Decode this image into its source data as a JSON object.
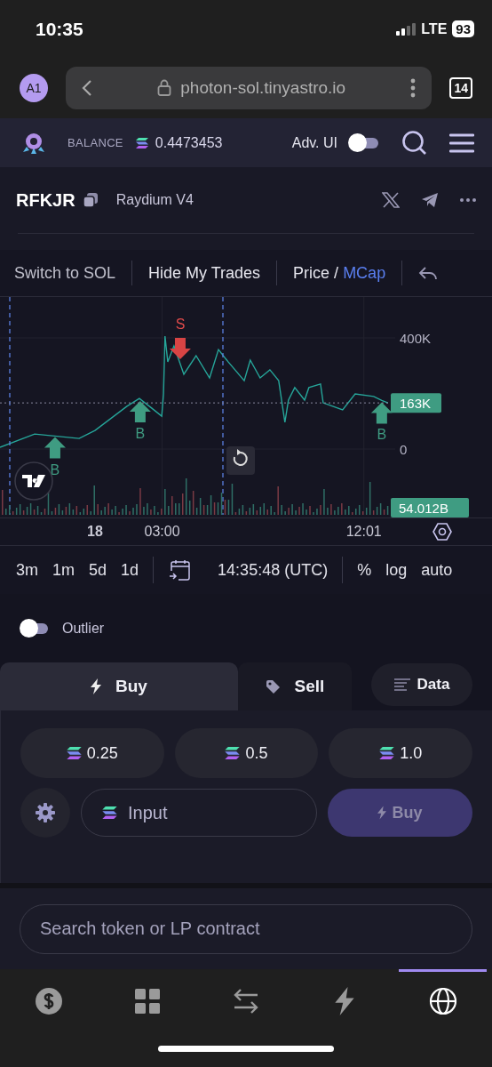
{
  "status_bar": {
    "time": "10:35",
    "network": "LTE",
    "battery": "93"
  },
  "browser": {
    "profile": "A1",
    "url": "photon-sol.tinyastro.io",
    "tab_count": "14"
  },
  "header": {
    "balance_label": "BALANCE",
    "balance": "0.4473453",
    "adv_ui_label": "Adv. UI",
    "adv_ui_on": false
  },
  "token": {
    "symbol": "RFKJR",
    "dex": "Raydium V4"
  },
  "chart_toolbar": {
    "switch_label": "Switch to SOL",
    "hide_trades_label": "Hide My Trades",
    "separator": "/",
    "modes": [
      {
        "label": "Price",
        "selected": false
      },
      {
        "label": "MCap",
        "selected": true
      }
    ]
  },
  "chart": {
    "price_label": "163K",
    "volume_label": "54.012B",
    "chart_data": {
      "type": "line",
      "x": [
        -4.25,
        -2.7,
        -0.71,
        0,
        1.43,
        1.98,
        2.54,
        2.98,
        3.06,
        3.13,
        3.25,
        3.53,
        3.97,
        4.52,
        5.12,
        5.52,
        5.95,
        6.67,
        6.94,
        7.38,
        7.82,
        8.21,
        8.49,
        8.65,
        8.93,
        9.37,
        9.56,
        10.08,
        10.2,
        11.07,
        11.63,
        12.46,
        12.82,
        13.1
      ],
      "series": [
        {
          "color": "#26a69a",
          "values": [
            6000,
            54000,
            38000,
            67000,
            154000,
            182000,
            147000,
            118000,
            198000,
            406000,
            314000,
            371000,
            269000,
            336000,
            256000,
            358000,
            314000,
            246000,
            320000,
            256000,
            285000,
            246000,
            96000,
            176000,
            221000,
            176000,
            221000,
            234000,
            166000,
            141000,
            198000,
            189000,
            175000,
            166000
          ]
        }
      ],
      "xlim": [
        -4.25,
        17.75
      ],
      "ylim": [
        -246400,
        547200
      ],
      "grid": true,
      "yticks": [
        {
          "value": 400000,
          "label": "400K"
        },
        {
          "value": 0,
          "label": "0"
        }
      ],
      "xticks": [
        {
          "value": 3,
          "label": "03:00"
        },
        {
          "value": 12.02,
          "label": "12:01"
        }
      ],
      "annotations": [
        {
          "text": "B",
          "x": -1.79,
          "y": 40000
        },
        {
          "text": "B",
          "x": 2.02,
          "y": 170000
        },
        {
          "text": "S",
          "x": 3.81,
          "y": 330000
        },
        {
          "text": "B",
          "x": 12.82,
          "y": 165000
        }
      ]
    },
    "day_label": "18"
  },
  "intervals": [
    {
      "label": "3m"
    },
    {
      "label": "1m"
    },
    {
      "label": "5d"
    },
    {
      "label": "1d"
    }
  ],
  "clock": "14:35:48 (UTC)",
  "scale_options": [
    {
      "label": "%"
    },
    {
      "label": "log"
    },
    {
      "label": "auto"
    }
  ],
  "outlier": {
    "label": "Outlier",
    "on": false
  },
  "trade_tabs": [
    {
      "kind": "buy",
      "label": "Buy",
      "selected": true
    },
    {
      "kind": "sell",
      "label": "Sell",
      "selected": false
    }
  ],
  "data_button": "Data",
  "quick_amounts": [
    "0.25",
    "0.5",
    "1.0"
  ],
  "amount_input": {
    "placeholder": "Input"
  },
  "buy_button": {
    "label": "Buy",
    "disabled": true
  },
  "search": {
    "placeholder": "Search token or LP contract"
  },
  "bottom_nav": [
    {
      "kind": "dollar",
      "selected": false
    },
    {
      "kind": "grid",
      "selected": false
    },
    {
      "kind": "swap",
      "selected": false
    },
    {
      "kind": "bolt",
      "selected": false
    },
    {
      "kind": "globe",
      "selected": true
    }
  ]
}
